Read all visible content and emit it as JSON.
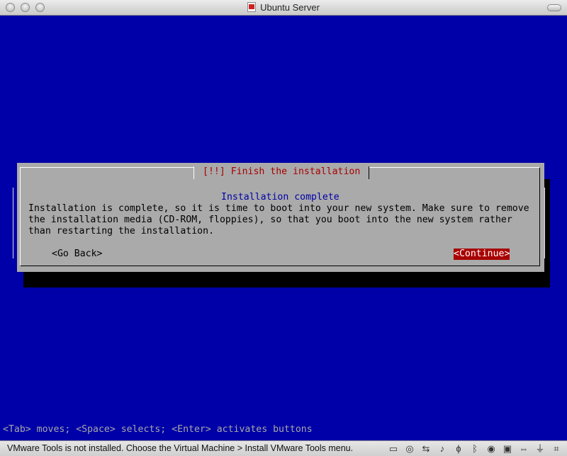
{
  "window": {
    "title": "Ubuntu Server"
  },
  "dialog": {
    "title": "[!!] Finish the installation",
    "subtitle": "Installation complete",
    "body": "Installation is complete, so it is time to boot into your new system. Make sure to remove\nthe installation media (CD-ROM, floppies), so that you boot into the new system rather\nthan restarting the installation.",
    "back_button": "<Go Back>",
    "continue_button": "<Continue>"
  },
  "hint": "<Tab> moves; <Space> selects; <Enter> activates buttons",
  "statusbar": {
    "message": "VMware Tools is not installed. Choose the Virtual Machine > Install VMware Tools menu.",
    "icons": [
      "hard-disk-icon",
      "cd-rom-icon",
      "network-icon",
      "sound-icon",
      "microphone-icon",
      "bluetooth-icon",
      "camera-icon",
      "printer-icon",
      "keyboard-icon",
      "usb-icon",
      "serial-icon"
    ]
  },
  "colors": {
    "console_bg": "#0000a8",
    "dialog_bg": "#aaaaaa",
    "title_red": "#a80000",
    "selected_bg": "#a80000"
  }
}
